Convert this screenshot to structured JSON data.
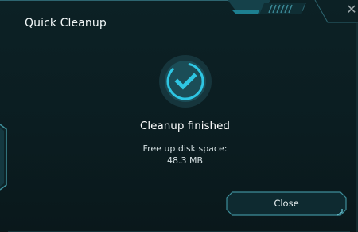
{
  "window": {
    "title": "Quick Cleanup",
    "close_glyph": "✕"
  },
  "status": {
    "title": "Cleanup finished",
    "space_label": "Free up disk space:",
    "space_value": "48.3 MB",
    "icon": "checkmark-icon"
  },
  "actions": {
    "close_label": "Close"
  },
  "colors": {
    "accent": "#1fb3cf",
    "frame": "#3e8e9a",
    "background": "#0b1d21"
  }
}
